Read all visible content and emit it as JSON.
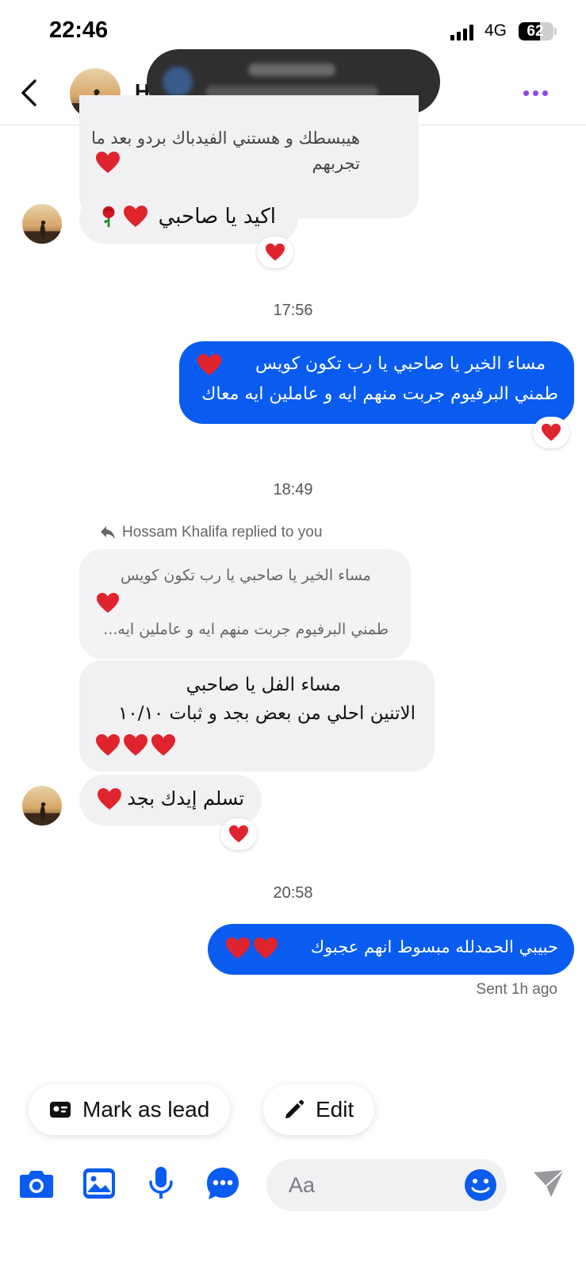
{
  "status_bar": {
    "time": "22:46",
    "network": "4G",
    "battery": "62",
    "battery_level": 0.62
  },
  "header": {
    "name_partial": "H",
    "back_icon": "chevron-left-icon",
    "more_icon": "more-dots-icon"
  },
  "messages": {
    "m1": {
      "line1": "هيبسطك و هستني الفيدباك بردو بعد ما",
      "line2": "تجربهم"
    },
    "m2": {
      "text": "اكيد يا صاحبي"
    },
    "time1": "17:56",
    "m3": {
      "line1": "مساء الخير يا صاحبي يا رب تكون كويس",
      "line2": "طمني البرفيوم جربت منهم ايه و عاملين ايه معاك"
    },
    "time2": "18:49",
    "reply_label": "Hossam Khalifa replied to you",
    "quote": {
      "line1": "مساء الخير يا صاحبي يا رب تكون كويس",
      "line2": "طمني البرفيوم جربت منهم ايه و عاملين ايه..."
    },
    "m4": {
      "line1": "مساء الفل يا صاحبي",
      "line2": "الاتنين احلي من بعض بجد و ثبات ١٠/١٠"
    },
    "m5": {
      "text": "تسلم إيدك بجد"
    },
    "time3": "20:58",
    "m6": {
      "text": "حبيبي الحمدلله مبسوط انهم عجبوك"
    },
    "sent_status": "Sent 1h ago"
  },
  "actions": {
    "mark_as_lead": "Mark as lead",
    "edit": "Edit"
  },
  "composer": {
    "placeholder": "Aa",
    "icons": [
      "camera-icon",
      "gallery-icon",
      "microphone-icon",
      "chat-bubble-icon",
      "emoji-icon",
      "send-icon"
    ]
  },
  "colors": {
    "accent": "#0a5cf0",
    "incoming_bubble": "#f1f1f4",
    "heart": "#e0242d",
    "more_dots": "#8e44e6"
  }
}
